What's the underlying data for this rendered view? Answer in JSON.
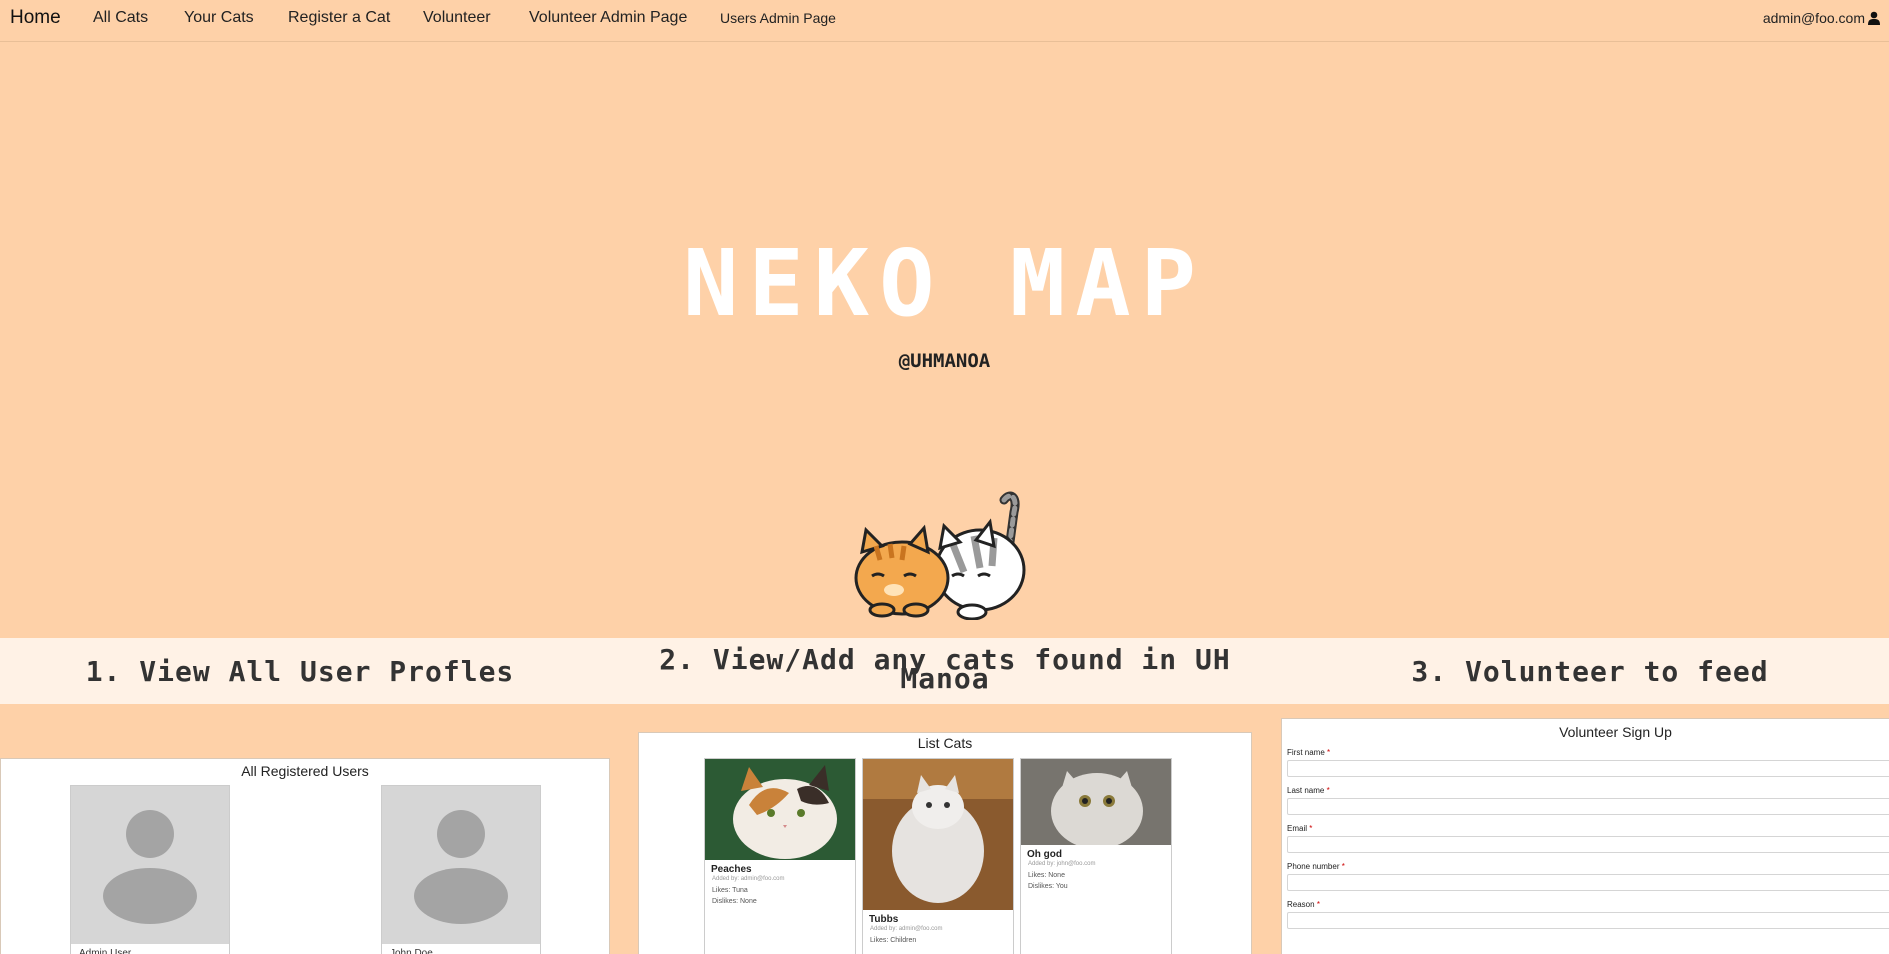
{
  "nav": {
    "brand": "Home",
    "links": [
      "All Cats",
      "Your Cats",
      "Register a Cat",
      "Volunteer",
      "Volunteer Admin Page",
      "Users Admin Page"
    ],
    "user_email": "admin@foo.com",
    "user_icon": "user-icon"
  },
  "hero": {
    "title": "NEKO MAP",
    "subtitle": "@UHMANOA"
  },
  "steps": [
    "1. View All User Profles",
    "2. View/Add any cats found in UH Manoa",
    "3. Volunteer to feed"
  ],
  "users_panel": {
    "title": "All Registered Users",
    "users": [
      {
        "name": "Admin User"
      },
      {
        "name": "John Doe"
      }
    ]
  },
  "cats_panel": {
    "title": "List Cats",
    "cats": [
      {
        "name": "Peaches",
        "added_by": "Added by: admin@foo.com",
        "likes": "Likes: Tuna",
        "dislikes": "Dislikes: None"
      },
      {
        "name": "Tubbs",
        "added_by": "Added by: admin@foo.com",
        "likes": "Likes: Children",
        "dislikes": ""
      },
      {
        "name": "Oh god",
        "added_by": "Added by: john@foo.com",
        "likes": "Likes: None",
        "dislikes": "Dislikes: You"
      }
    ]
  },
  "volunteer_panel": {
    "title": "Volunteer Sign Up",
    "fields": [
      "First name",
      "Last name",
      "Email",
      "Phone number",
      "Reason"
    ],
    "required_mark": "*"
  }
}
